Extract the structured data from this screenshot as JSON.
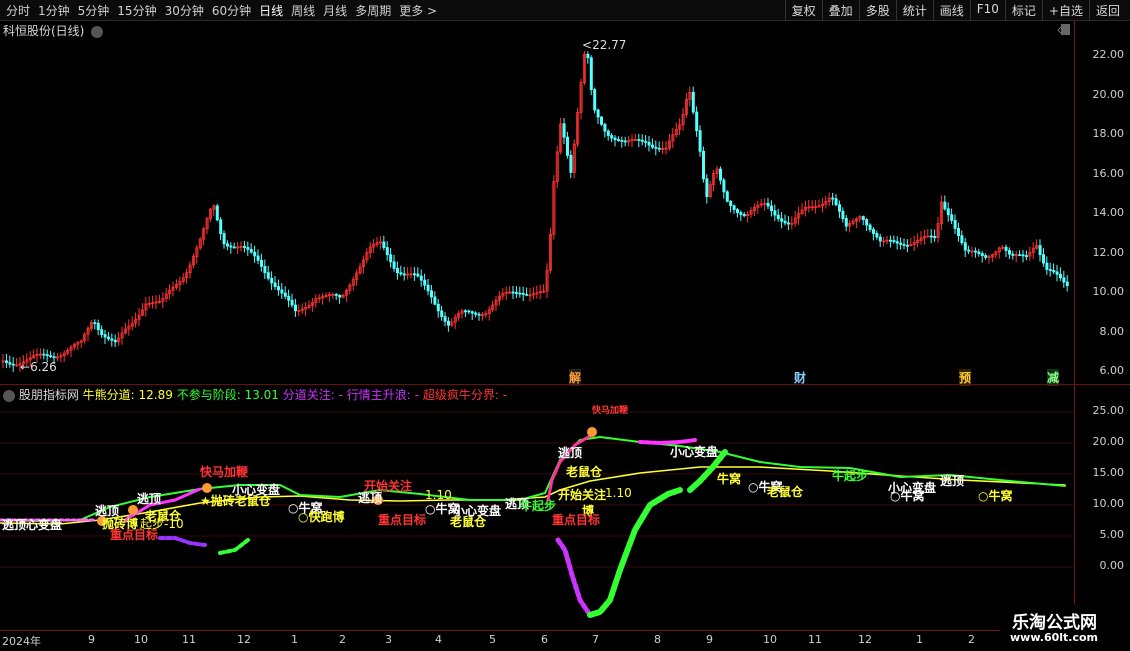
{
  "toolbar": {
    "periods": [
      "分时",
      "1分钟",
      "5分钟",
      "15分钟",
      "30分钟",
      "60分钟",
      "日线",
      "周线",
      "月线",
      "多周期",
      "更多"
    ],
    "active": "日线",
    "right": [
      "复权",
      "叠加",
      "多股",
      "统计",
      "画线",
      "F10",
      "标记",
      "+自选",
      "返回"
    ]
  },
  "main_pane": {
    "title": "科恒股份(日线)",
    "price_high": "22.77",
    "price_low": "6.26",
    "yticks": [
      "22.00",
      "20.00",
      "18.00",
      "16.00",
      "14.00",
      "12.00",
      "10.00",
      "8.00",
      "6.00"
    ],
    "events": [
      "解",
      "财",
      "预",
      "减"
    ]
  },
  "indicator_pane": {
    "name": "股朋指标网",
    "legend": [
      {
        "label": "牛熊分道: ",
        "value": "12.89",
        "color": "#ffff33"
      },
      {
        "label": "不参与阶段: ",
        "value": "13.01",
        "color": "#33ff33"
      },
      {
        "label": "分道关注: ",
        "value": "-",
        "color": "#cc33ff"
      },
      {
        "label": "行情主升浪: ",
        "value": "-",
        "color": "#cc33ff"
      },
      {
        "label": "超级疯牛分界: ",
        "value": "-",
        "color": "#ff3333"
      }
    ],
    "yticks": [
      "25.00",
      "20.00",
      "15.00",
      "10.00",
      "5.00",
      "0.00"
    ],
    "annotations": {
      "a1": "逃顶心变盘",
      "a2": "逃顶",
      "a3": "抛砖博",
      "a4": "老鼠仓",
      "a5": "重点目标",
      "a6": "逃顶",
      "a7": "快马加鞭",
      "a8": "★抛砖老鼠仓",
      "a9": "小心变盘",
      "a10": "○牛窝",
      "a11": "○快跑博",
      "a12": "开始关注",
      "a13": "逃顶",
      "a14": "重点目标",
      "a15": "1.10",
      "a16": "○牛窝",
      "a17": "小心变盘",
      "a18": "老鼠仓",
      "a19": "逃顶",
      "a20": "博",
      "a21": "逃顶",
      "a22": "老鼠仓",
      "a23": "开始关注",
      "a24": "1.10",
      "a25": "重点目标",
      "a26": "快马加鞭",
      "a27": "小心变盘",
      "a28": "牛窝",
      "a29": "○牛窝",
      "a30": "老鼠仓",
      "a31": "牛起步",
      "a32": "小心变盘",
      "a33": "○牛窝",
      "a34": "逃顶",
      "a35": "○牛窝",
      "a36": "牛起步",
      "a37": "起步-10"
    }
  },
  "xaxis": {
    "labels": [
      "2024年",
      "9",
      "10",
      "11",
      "12",
      "1",
      "2",
      "3",
      "4",
      "5",
      "6",
      "7",
      "8",
      "9",
      "10",
      "11",
      "12",
      "1",
      "2"
    ]
  },
  "watermark": {
    "line1": "乐淘公式网",
    "line2": "www.60lt.com"
  },
  "colors": {
    "up": "#ff3232",
    "down": "#54ffff",
    "yellow": "#ffff33",
    "green": "#33ff33",
    "magenta": "#ff33ff",
    "purple": "#9933ff",
    "grid": "#6a0f0f"
  }
}
